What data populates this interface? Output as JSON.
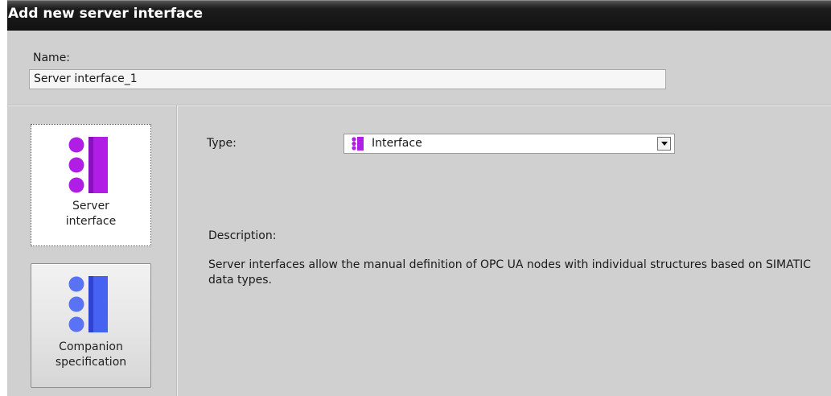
{
  "dialog": {
    "title": "Add new server interface"
  },
  "name": {
    "label": "Name:",
    "value": "Server interface_1"
  },
  "tiles": [
    {
      "label_line1": "Server",
      "label_line2": "interface",
      "icon": "server-interface-icon",
      "color": "#b01ee6",
      "selected": true
    },
    {
      "label_line1": "Companion",
      "label_line2": "specification",
      "icon": "companion-specification-icon",
      "color": "#3c5cf0",
      "selected": false
    }
  ],
  "type": {
    "label": "Type:",
    "value": "Interface",
    "icon": "interface-icon",
    "icon_color": "#b01ee6"
  },
  "description": {
    "label": "Description:",
    "text": "Server interfaces allow the manual definition of OPC UA nodes with individual structures based on SIMATIC data types."
  }
}
